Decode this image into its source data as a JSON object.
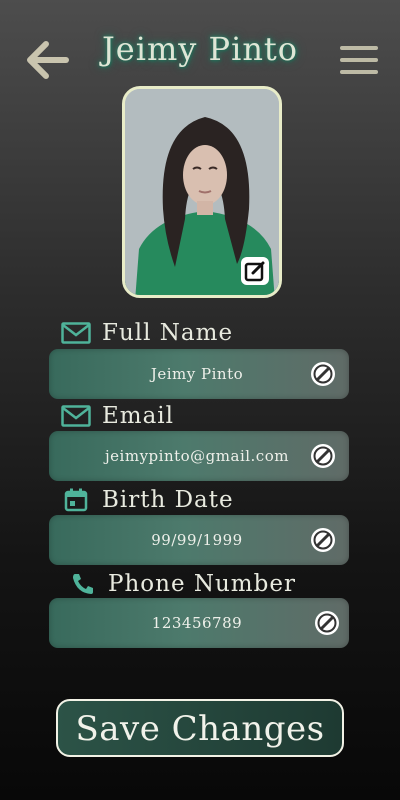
{
  "header": {
    "title": "Jeimy Pinto",
    "back_icon": "arrow-left-icon",
    "menu_icon": "hamburger-menu-icon"
  },
  "profile": {
    "photo_alt": "profile photo",
    "edit_icon": "edit-square-icon"
  },
  "fields": [
    {
      "label": "Full Name",
      "value": "Jeimy Pinto",
      "icon": "mail-icon"
    },
    {
      "label": "Email",
      "value": "jeimypinto@gmail.com",
      "icon": "mail-icon"
    },
    {
      "label": "Birth Date",
      "value": "99/99/1999",
      "icon": "calendar-icon"
    },
    {
      "label": "Phone Number",
      "value": "123456789",
      "icon": "phone-icon"
    }
  ],
  "actions": {
    "save_label": "Save Changes"
  },
  "colors": {
    "accent": "#5fb8a0",
    "field_start": "#386a5c",
    "field_end": "#606b67",
    "button_bg": "#1e3a32",
    "text": "#e8eadf"
  }
}
